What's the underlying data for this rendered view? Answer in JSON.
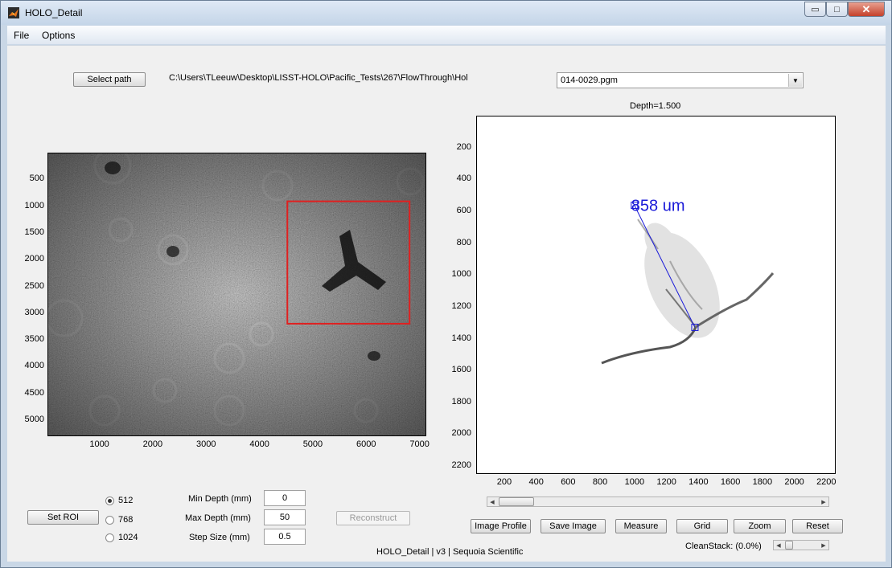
{
  "window": {
    "title": "HOLO_Detail",
    "min_glyph": "▭",
    "max_glyph": "□",
    "close_glyph": "✕"
  },
  "menu": {
    "file": "File",
    "options": "Options"
  },
  "path": {
    "button": "Select path",
    "value": "C:\\Users\\TLeeuw\\Desktop\\LISST-HOLO\\Pacific_Tests\\267\\FlowThrough\\Hol"
  },
  "file_select": {
    "value": "014-0029.pgm"
  },
  "left_image": {
    "y_ticks": [
      "500",
      "1000",
      "1500",
      "2000",
      "2500",
      "3000",
      "3500",
      "4000",
      "4500",
      "5000"
    ],
    "x_ticks": [
      "1000",
      "2000",
      "3000",
      "4000",
      "5000",
      "6000",
      "7000"
    ],
    "roi": {
      "x0": 4500,
      "x1": 6800,
      "y0": 900,
      "y1": 3200
    }
  },
  "right_image": {
    "title": "Depth=1.500",
    "y_ticks": [
      "200",
      "400",
      "600",
      "800",
      "1000",
      "1200",
      "1400",
      "1600",
      "1800",
      "2000",
      "2200"
    ],
    "x_ticks": [
      "200",
      "400",
      "600",
      "800",
      "1000",
      "1200",
      "1400",
      "1600",
      "1800",
      "2000",
      "2200"
    ],
    "measure_label": "858 um",
    "measure_line": {
      "x0": 990,
      "y0": 560,
      "x1": 1370,
      "y1": 1330
    }
  },
  "roi_controls": {
    "set_roi": "Set ROI",
    "options": [
      {
        "label": "512",
        "selected": true
      },
      {
        "label": "768",
        "selected": false
      },
      {
        "label": "1024",
        "selected": false
      }
    ]
  },
  "depth": {
    "min_label": "Min Depth (mm)",
    "min_value": "0",
    "max_label": "Max Depth (mm)",
    "max_value": "50",
    "step_label": "Step Size (mm)",
    "step_value": "0.5"
  },
  "reconstruct": "Reconstruct",
  "toolbar": {
    "image_profile": "Image Profile",
    "save_image": "Save Image",
    "measure": "Measure",
    "grid": "Grid",
    "zoom": "Zoom",
    "reset": "Reset"
  },
  "cleanstack": {
    "label": "CleanStack:  (0.0%)"
  },
  "footer": "HOLO_Detail | v3 | Sequoia Scientific",
  "colors": {
    "roi": "#e02020",
    "measure": "#1a1ad8"
  }
}
